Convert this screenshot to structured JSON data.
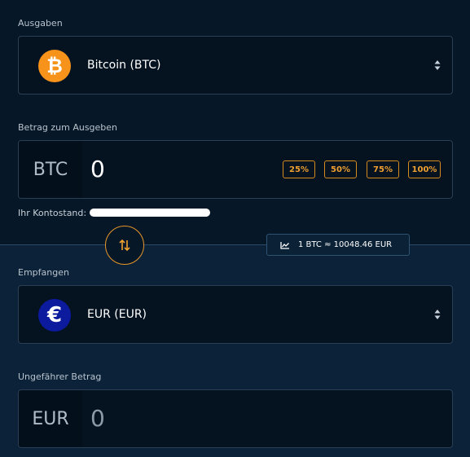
{
  "spend": {
    "label": "Ausgaben",
    "coin_name": "Bitcoin (BTC)",
    "coin_symbol": "₿"
  },
  "spend_amount": {
    "label": "Betrag zum Ausgeben",
    "currency": "BTC",
    "value": "0",
    "percent_buttons": [
      "25%",
      "50%",
      "75%",
      "100%"
    ]
  },
  "balance": {
    "label": "Ihr Kontostand:"
  },
  "rate": {
    "text": "1 BTC ≈ 10048.46 EUR"
  },
  "receive": {
    "label": "Empfangen",
    "coin_name": "EUR (EUR)",
    "coin_symbol": "€"
  },
  "receive_amount": {
    "label": "Ungefährer Betrag",
    "currency": "EUR",
    "value": "0"
  },
  "colors": {
    "accent": "#f0a030",
    "btc": "#f7931a",
    "eur": "#0c1a9e"
  }
}
